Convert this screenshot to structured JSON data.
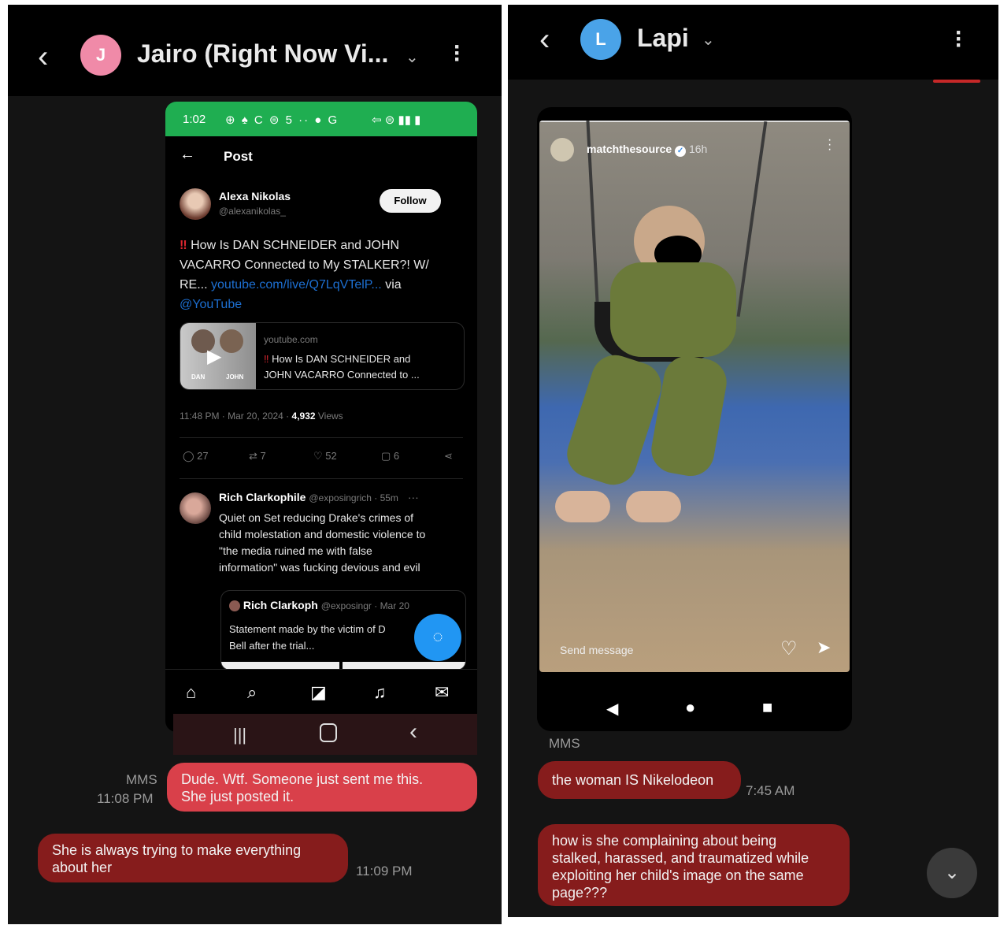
{
  "left": {
    "header": {
      "title": "Jairo (Right Now Vi...",
      "avatar_letter": "J",
      "avatar_color": "#f08aa8"
    },
    "embedded": {
      "status_time": "1:02",
      "status_icons": "⊕ ♠ C ⊜ 5 ·· ● G",
      "status_right": "⇦ ⊜ ▮▮ ▮",
      "post_title": "Post",
      "author_name": "Alexa Nikolas",
      "author_handle": "@alexanikolas_",
      "follow_label": "Follow",
      "tweet_line1": "How Is DAN SCHNEIDER and JOHN",
      "tweet_line2": "VACARRO Connected to My STALKER?! W/",
      "tweet_line3_a": "RE...",
      "tweet_line3_link": "youtube.com/live/Q7LqVTelP...",
      "tweet_line3_b": "via",
      "tweet_line4": "@YouTube",
      "card_domain": "youtube.com",
      "card_title1": "How Is DAN SCHNEIDER and",
      "card_title2": "JOHN VACARRO Connected to ...",
      "thumb_label_left": "DAN",
      "thumb_label_right": "JOHN",
      "meta_time": "11:48 PM · Mar 20, 2024 · ",
      "meta_views_count": "4,932",
      "meta_views_label": " Views",
      "stat_replies": "27",
      "stat_reposts": "7",
      "stat_likes": "52",
      "stat_bookmarks": "6",
      "reply_name": "Rich Clarkophile",
      "reply_handle": "@exposingrich · 55m",
      "reply_line1": "Quiet on Set reducing Drake's crimes of",
      "reply_line2": "child molestation and domestic violence  to",
      "reply_line3": "\"the media ruined me with false",
      "reply_line4": "information\" was fucking devious and evil",
      "quote_name": "Rich Clarkoph",
      "quote_handle": "@exposingr · Mar 20",
      "quote_line1": "Statement made by the victim of D",
      "quote_line2": "Bell after the trial..."
    },
    "messages": [
      {
        "label": "MMS",
        "time": "11:08 PM",
        "text_line1": "Dude. Wtf. Someone just sent me this.",
        "text_line2": "She just posted it."
      },
      {
        "time": "11:09 PM",
        "text_line1": "She is always trying to make everything",
        "text_line2": "about her"
      }
    ]
  },
  "right": {
    "header": {
      "title": "Lapi",
      "avatar_letter": "L",
      "avatar_color": "#4aa3e8"
    },
    "story": {
      "username": "matchthesource",
      "age": "16h",
      "send_placeholder": "Send message"
    },
    "mms_label": "MMS",
    "messages": [
      {
        "time": "7:45 AM",
        "text": "the woman IS Nikelodeon"
      },
      {
        "line1": "how is she complaining about being",
        "line2": "stalked, harassed, and traumatized while",
        "line3": "exploiting her child's image on the same",
        "line4": "page???"
      }
    ]
  },
  "colors": {
    "sent_bubble": "#d9404a",
    "received_bubble": "#861c1c",
    "status_green": "#1fae51",
    "fab_blue": "#2196f3"
  }
}
